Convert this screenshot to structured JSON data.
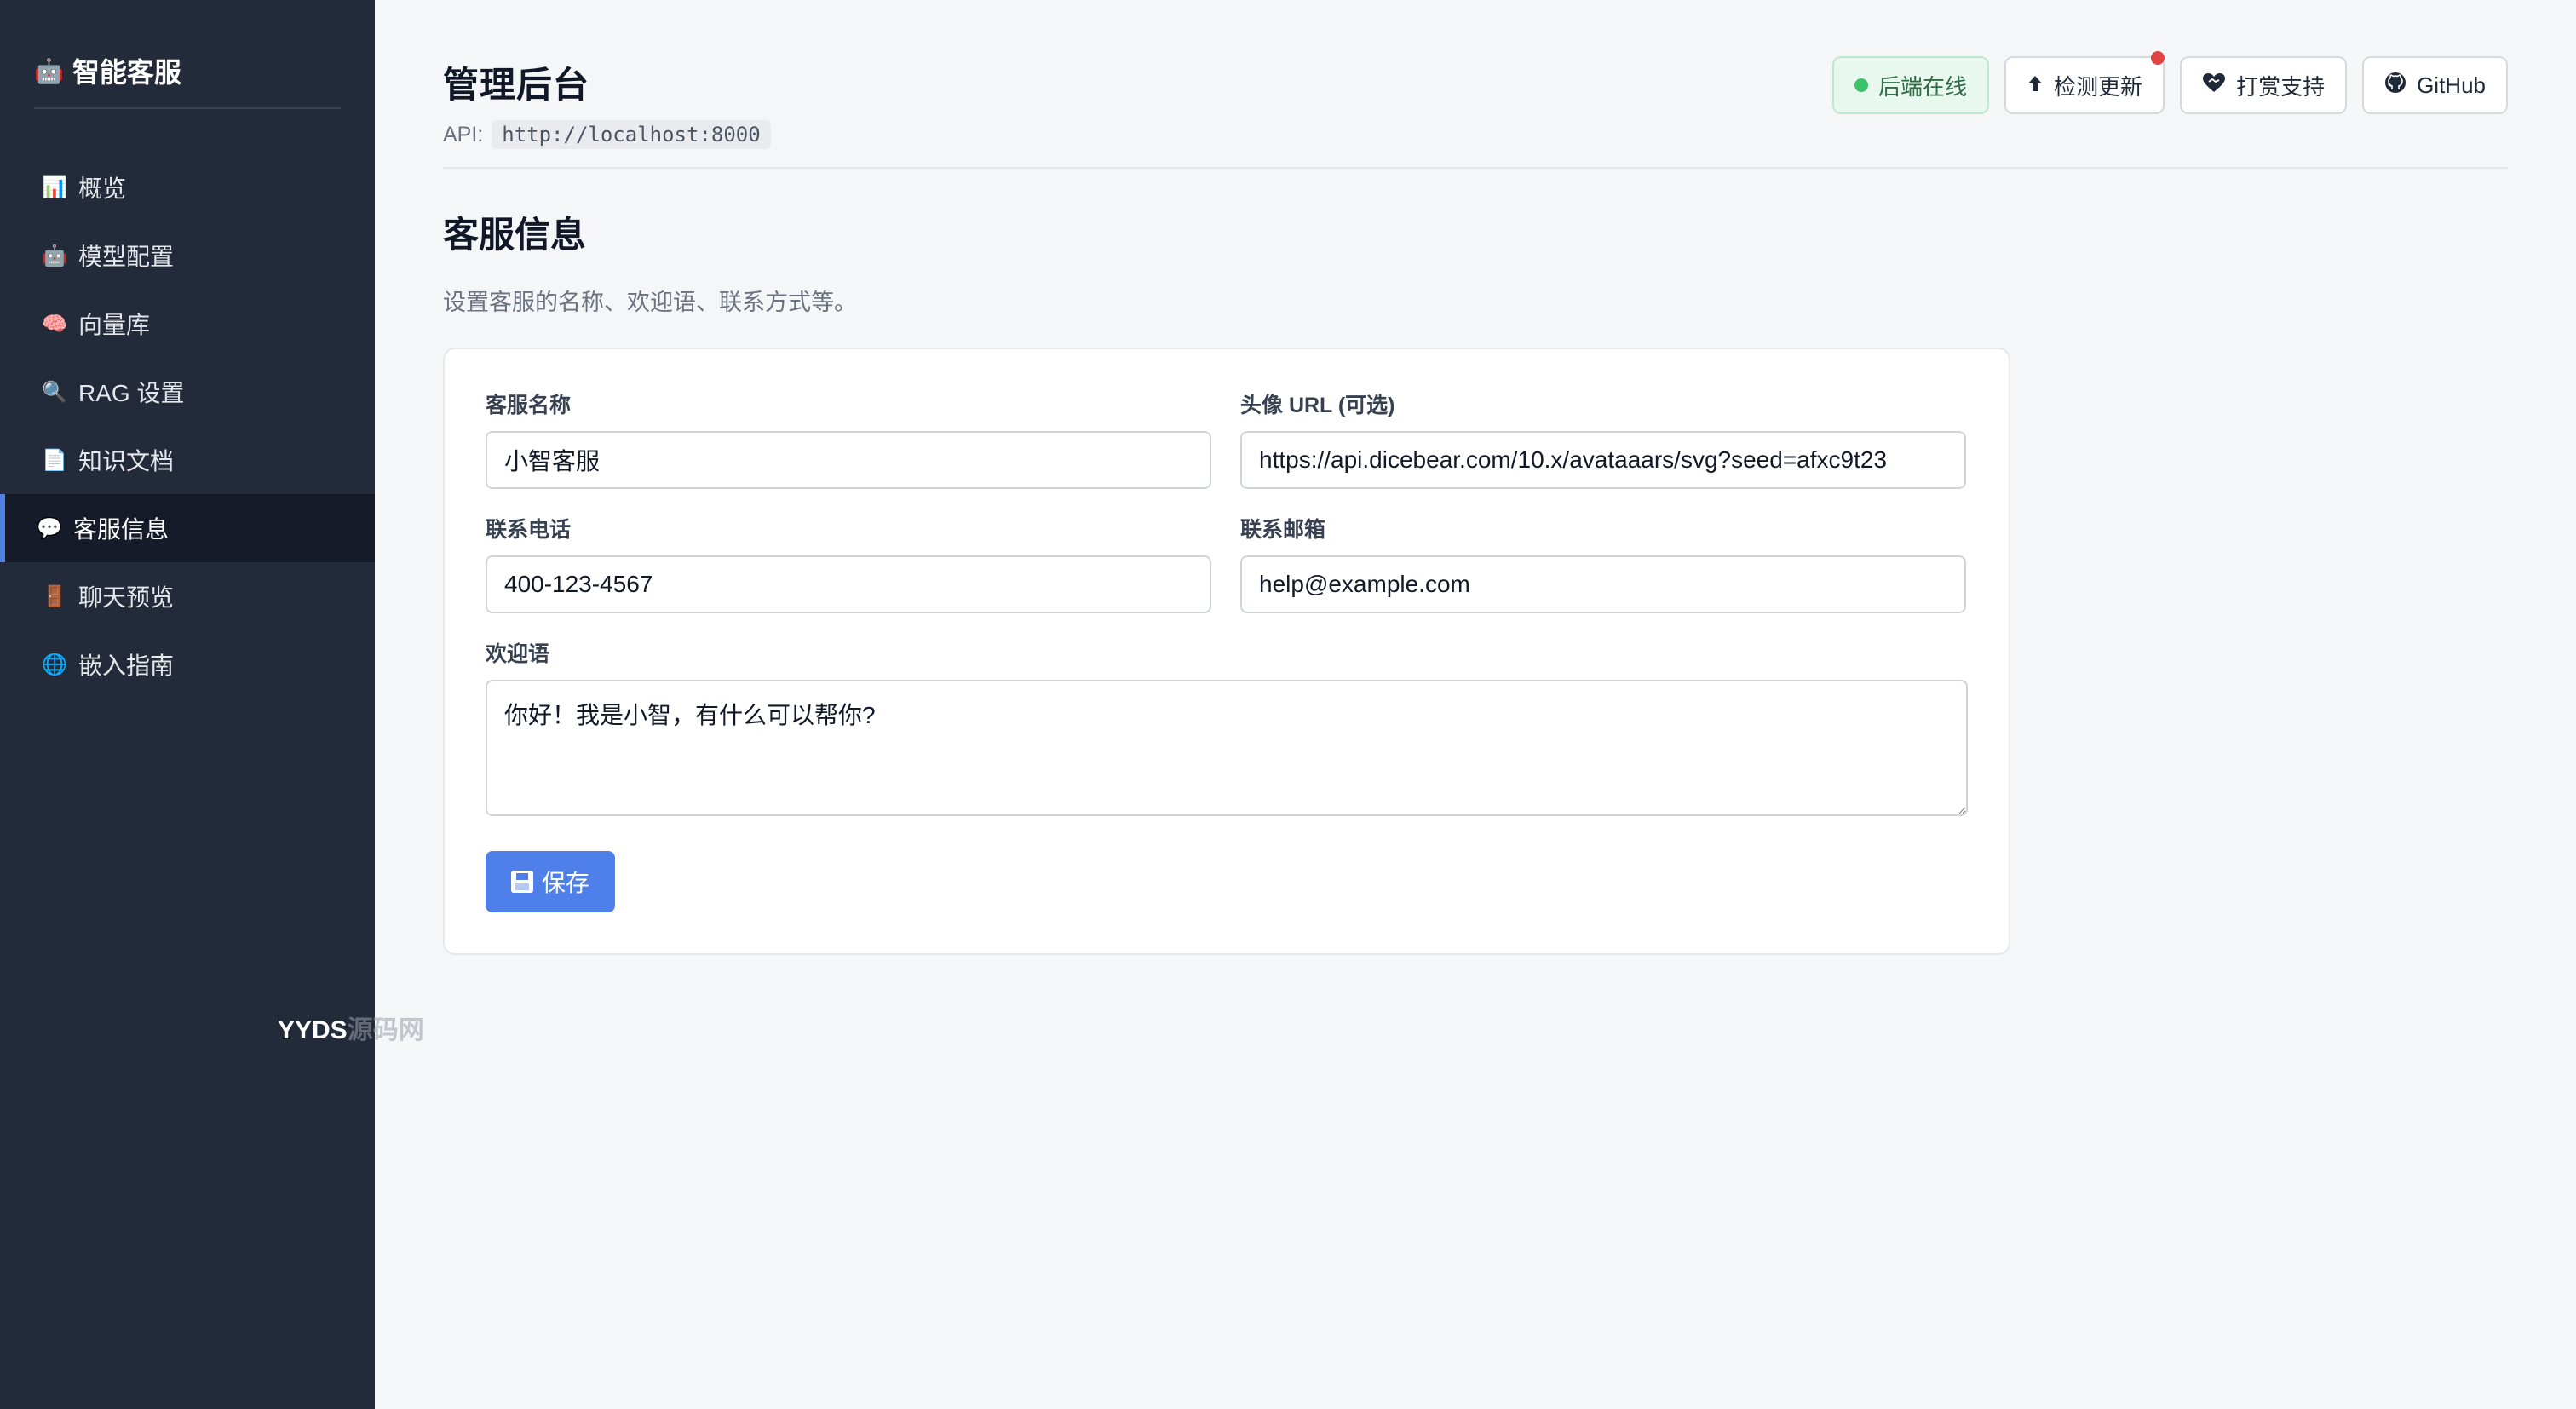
{
  "sidebar": {
    "brand_icon": "robot-icon",
    "brand": "智能客服",
    "items": [
      {
        "icon": "📊",
        "label": "概览",
        "active": false
      },
      {
        "icon": "🤖",
        "label": "模型配置",
        "active": false
      },
      {
        "icon": "🧠",
        "label": "向量库",
        "active": false
      },
      {
        "icon": "🔍",
        "label": "RAG 设置",
        "active": false
      },
      {
        "icon": "📄",
        "label": "知识文档",
        "active": false
      },
      {
        "icon": "💬",
        "label": "客服信息",
        "active": true
      },
      {
        "icon": "🚪",
        "label": "聊天预览",
        "active": false
      },
      {
        "icon": "🌐",
        "label": "嵌入指南",
        "active": false
      }
    ],
    "watermark_main": "YYDS",
    "watermark_fade": "源码网"
  },
  "header": {
    "title": "管理后台",
    "api_label": "API:",
    "api_url": "http://localhost:8000",
    "actions": {
      "status": "后端在线",
      "update": "检测更新",
      "support": "打赏支持",
      "github": "GitHub"
    }
  },
  "section": {
    "title": "客服信息",
    "description": "设置客服的名称、欢迎语、联系方式等。"
  },
  "form": {
    "name_label": "客服名称",
    "name_value": "小智客服",
    "avatar_label": "头像 URL (可选)",
    "avatar_value": "https://api.dicebear.com/10.x/avataaars/svg?seed=afxc9t23",
    "phone_label": "联系电话",
    "phone_value": "400-123-4567",
    "email_label": "联系邮箱",
    "email_value": "help@example.com",
    "welcome_label": "欢迎语",
    "welcome_value": "你好！我是小智，有什么可以帮你?",
    "save_label": "保存"
  },
  "colors": {
    "sidebar_bg": "#232a39",
    "accent": "#4f80ea",
    "status_green": "#3cc26b",
    "notify_red": "#e04343"
  }
}
